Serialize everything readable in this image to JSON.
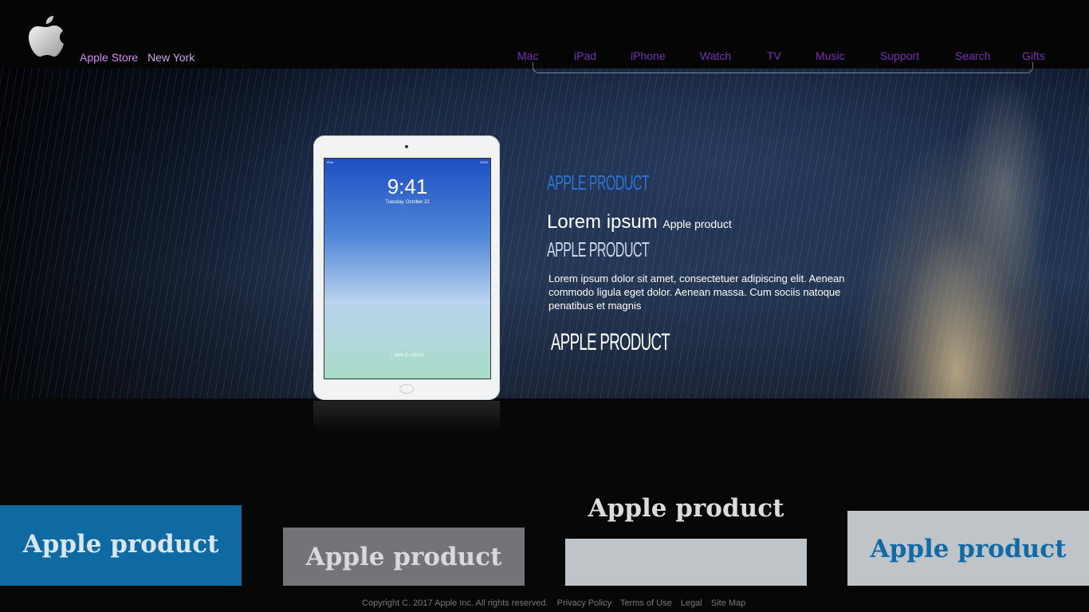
{
  "header": {
    "brand_store": "Apple Store",
    "brand_city": "New York",
    "nav": [
      {
        "label": "Mac"
      },
      {
        "label": "iPad"
      },
      {
        "label": "iPhone"
      },
      {
        "label": "Watch"
      },
      {
        "label": "TV"
      },
      {
        "label": "Music"
      },
      {
        "label": "Support"
      },
      {
        "label": "Search"
      },
      {
        "label": "Gifts"
      }
    ],
    "accent_color": "#7a2fb8",
    "logo_icon": "apple-logo-icon"
  },
  "hero": {
    "heading": "APPLE PRODUCT",
    "lorem_large": "Lorem ipsum",
    "lorem_small": "Apple product",
    "subheading": "APPLE PRODUCT",
    "paragraph": "Lorem ipsum dolor sit amet, consectetuer adipiscing elit. Aenean commodo ligula eget dolor. Aenean massa. Cum sociis natoque penatibus et magnis",
    "subheading2": "APPLE PRODUCT",
    "device": {
      "time": "9:41",
      "date": "Tuesday, October 22",
      "unlock": "› slide to unlock",
      "carrier": "iPad",
      "battery": "100%"
    }
  },
  "tiles": [
    {
      "label": "Apple product",
      "bg": "#0e6aa0"
    },
    {
      "label": "Apple product",
      "bg": "#747478"
    },
    {
      "label": "Apple product",
      "bg": "#bfc4c8"
    },
    {
      "label": "Apple product",
      "bg": "#bfc4c8"
    }
  ],
  "footer": {
    "copyright": "Copyright C. 2017  Apple Inc.  All rights reserved.",
    "links": [
      "Privacy Policy",
      "Terms of Use",
      "Legal",
      "Site Map"
    ]
  }
}
